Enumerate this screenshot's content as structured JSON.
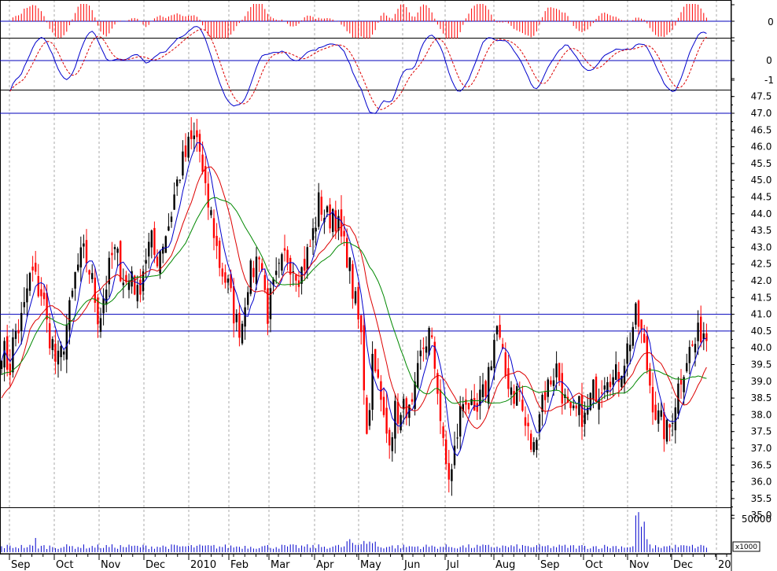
{
  "chart_data": {
    "type": "candlestick",
    "x_axis": {
      "labels": [
        "Sep",
        "Oct",
        "Nov",
        "Dec",
        "2010",
        "Feb",
        "Mar",
        "Apr",
        "May",
        "Jun",
        "Jul",
        "Aug",
        "Sep",
        "Oct",
        "Nov",
        "Dec",
        "20"
      ]
    },
    "price_panel": {
      "ylim": [
        34.6,
        47.6
      ],
      "tick_labels": [
        "47.5",
        "47.0",
        "46.5",
        "46.0",
        "45.5",
        "45.0",
        "44.5",
        "44.0",
        "43.5",
        "43.0",
        "42.5",
        "42.0",
        "41.5",
        "41.0",
        "40.5",
        "40.0",
        "39.5",
        "39.0",
        "38.5",
        "38.0",
        "37.5",
        "37.0",
        "36.5",
        "36.0",
        "35.5",
        "35.0"
      ],
      "horizontal_lines": [
        47.0,
        41.0,
        40.5
      ],
      "price_path": [
        [
          0,
          40.2
        ],
        [
          6,
          39.8
        ],
        [
          12,
          39.3
        ],
        [
          18,
          40.4
        ],
        [
          24,
          40.6
        ],
        [
          30,
          41.0
        ],
        [
          36,
          42.0
        ],
        [
          42,
          42.2
        ],
        [
          48,
          41.8
        ],
        [
          54,
          41.6
        ],
        [
          60,
          40.6
        ],
        [
          66,
          40.2
        ],
        [
          72,
          39.4
        ],
        [
          78,
          39.8
        ],
        [
          84,
          40.6
        ],
        [
          90,
          41.2
        ],
        [
          96,
          42.2
        ],
        [
          102,
          42.6
        ],
        [
          108,
          42.8
        ],
        [
          114,
          42.3
        ],
        [
          120,
          41.6
        ],
        [
          126,
          40.8
        ],
        [
          132,
          41.6
        ],
        [
          138,
          42.2
        ],
        [
          144,
          42.9
        ],
        [
          150,
          42.6
        ],
        [
          156,
          42.2
        ],
        [
          162,
          41.8
        ],
        [
          168,
          42.4
        ],
        [
          174,
          41.4
        ],
        [
          180,
          42.2
        ],
        [
          186,
          42.8
        ],
        [
          192,
          43.2
        ],
        [
          198,
          42.6
        ],
        [
          204,
          43.0
        ],
        [
          210,
          43.4
        ],
        [
          216,
          43.8
        ],
        [
          222,
          44.6
        ],
        [
          228,
          45.2
        ],
        [
          234,
          45.6
        ],
        [
          240,
          46.0
        ],
        [
          246,
          46.2
        ],
        [
          252,
          46.3
        ],
        [
          256,
          45.4
        ],
        [
          260,
          44.6
        ],
        [
          266,
          44.2
        ],
        [
          272,
          43.5
        ],
        [
          278,
          42.6
        ],
        [
          284,
          42.2
        ],
        [
          290,
          41.8
        ],
        [
          296,
          41.2
        ],
        [
          302,
          40.6
        ],
        [
          308,
          40.8
        ],
        [
          314,
          42.0
        ],
        [
          320,
          42.2
        ],
        [
          326,
          42.6
        ],
        [
          330,
          43.0
        ],
        [
          336,
          41.8
        ],
        [
          340,
          41.0
        ],
        [
          346,
          41.6
        ],
        [
          352,
          42.0
        ],
        [
          358,
          42.4
        ],
        [
          364,
          42.8
        ],
        [
          370,
          42.6
        ],
        [
          376,
          42.4
        ],
        [
          382,
          42.2
        ],
        [
          388,
          42.6
        ],
        [
          394,
          43.0
        ],
        [
          400,
          43.6
        ],
        [
          406,
          44.4
        ],
        [
          412,
          44.0
        ],
        [
          418,
          43.8
        ],
        [
          424,
          44.2
        ],
        [
          430,
          43.6
        ],
        [
          436,
          43.0
        ],
        [
          442,
          42.8
        ],
        [
          448,
          41.8
        ],
        [
          454,
          41.0
        ],
        [
          460,
          40.2
        ],
        [
          464,
          38.4
        ],
        [
          468,
          37.2
        ],
        [
          472,
          39.6
        ],
        [
          476,
          40.0
        ],
        [
          480,
          39.0
        ],
        [
          486,
          38.0
        ],
        [
          492,
          37.4
        ],
        [
          498,
          37.6
        ],
        [
          504,
          38.2
        ],
        [
          510,
          37.8
        ],
        [
          516,
          38.4
        ],
        [
          522,
          37.8
        ],
        [
          528,
          38.6
        ],
        [
          534,
          39.6
        ],
        [
          540,
          40.2
        ],
        [
          546,
          40.4
        ],
        [
          552,
          39.6
        ],
        [
          558,
          38.6
        ],
        [
          562,
          37.2
        ],
        [
          566,
          36.6
        ],
        [
          570,
          36.2
        ],
        [
          574,
          36.2
        ],
        [
          580,
          37.2
        ],
        [
          586,
          38.2
        ],
        [
          592,
          38.6
        ],
        [
          598,
          38.2
        ],
        [
          604,
          37.6
        ],
        [
          610,
          38.4
        ],
        [
          616,
          38.6
        ],
        [
          622,
          39.4
        ],
        [
          628,
          40.2
        ],
        [
          632,
          40.6
        ],
        [
          636,
          40.0
        ],
        [
          642,
          39.2
        ],
        [
          648,
          39.0
        ],
        [
          654,
          38.6
        ],
        [
          660,
          38.8
        ],
        [
          666,
          37.8
        ],
        [
          672,
          37.4
        ],
        [
          678,
          36.8
        ],
        [
          684,
          38.0
        ],
        [
          690,
          38.6
        ],
        [
          696,
          38.8
        ],
        [
          702,
          39.2
        ],
        [
          708,
          39.4
        ],
        [
          714,
          38.8
        ],
        [
          720,
          38.2
        ],
        [
          726,
          37.8
        ],
        [
          732,
          38.0
        ],
        [
          738,
          38.2
        ],
        [
          744,
          37.8
        ],
        [
          750,
          38.4
        ],
        [
          756,
          38.8
        ],
        [
          762,
          38.8
        ],
        [
          768,
          39.2
        ],
        [
          774,
          39.4
        ],
        [
          780,
          39.0
        ],
        [
          786,
          39.2
        ],
        [
          792,
          39.6
        ],
        [
          798,
          40.0
        ],
        [
          804,
          40.6
        ],
        [
          808,
          40.9
        ],
        [
          814,
          40.6
        ],
        [
          820,
          39.8
        ],
        [
          826,
          39.0
        ],
        [
          832,
          38.2
        ],
        [
          838,
          37.8
        ],
        [
          844,
          37.6
        ],
        [
          850,
          37.4
        ],
        [
          856,
          38.2
        ],
        [
          862,
          38.8
        ],
        [
          868,
          39.4
        ],
        [
          874,
          39.8
        ],
        [
          880,
          40.0
        ],
        [
          886,
          40.2
        ],
        [
          892,
          40.6
        ],
        [
          898,
          40.4
        ],
        [
          902,
          40.1
        ]
      ]
    },
    "oscillator_panel": {
      "tick_labels": [
        "0",
        "-1"
      ]
    },
    "histogram_panel": {
      "tick_labels": [
        "0"
      ]
    },
    "volume_panel": {
      "tick_labels": [
        "50000"
      ],
      "unit_label": "x1000"
    },
    "colors": {
      "up_candle": "#000000",
      "down_candle": "#ff0000",
      "ma_short": "#0000cc",
      "ma_mid": "#dd0000",
      "ma_long": "#008800",
      "reference_line": "#0000bb",
      "volume_bar": "#0000cc"
    }
  }
}
